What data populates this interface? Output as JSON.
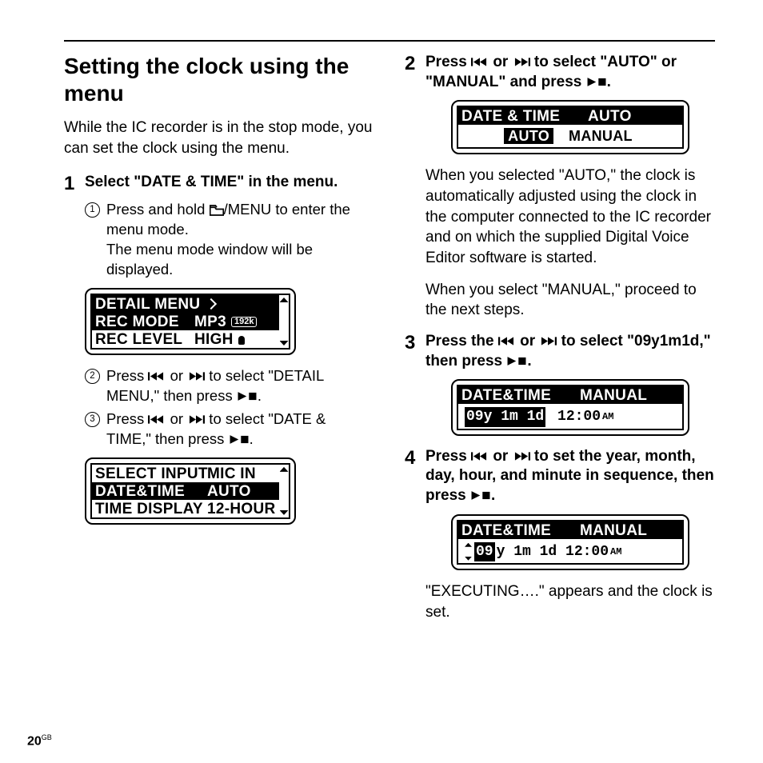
{
  "page_number": "20",
  "page_suffix": "GB",
  "left": {
    "title": "Setting the clock using the menu",
    "intro": "While the IC recorder is in the stop mode, you can set the clock using the menu.",
    "step1": {
      "num": "1",
      "head": "Select \"DATE & TIME\" in the menu.",
      "sub1_a": "Press and hold ",
      "sub1_b": "/MENU to enter the menu mode.",
      "sub1_after": "The menu mode window will be displayed.",
      "sub2_a": "Press ",
      "sub2_b": " or ",
      "sub2_c": " to select \"DETAIL MENU,\" then press ",
      "sub2_d": ".",
      "sub3_a": "Press ",
      "sub3_b": " or ",
      "sub3_c": " to select \"DATE & TIME,\" then press ",
      "sub3_d": "."
    }
  },
  "right": {
    "step2": {
      "num": "2",
      "head_a": "Press ",
      "head_b": " or ",
      "head_c": " to select \"AUTO\" or \"MANUAL\" and press ",
      "head_d": ".",
      "para1": "When you selected \"AUTO,\"  the clock is automatically adjusted using the clock in the computer connected to the IC recorder and on which the supplied Digital Voice Editor software is started.",
      "para2": "When you select \"MANUAL,\" proceed to the next steps."
    },
    "step3": {
      "num": "3",
      "head_a": "Press the ",
      "head_b": " or ",
      "head_c": " to select \"09y1m1d,\" then press ",
      "head_d": "."
    },
    "step4": {
      "num": "4",
      "head_a": "Press ",
      "head_b": " or ",
      "head_c": " to set the year, month, day, hour, and minute in sequence, then press ",
      "head_d": ".",
      "after": "\"EXECUTING….\" appears and the clock is set."
    }
  },
  "lcd": {
    "fig1": {
      "r1l": "DETAIL MENU",
      "r1r": "",
      "r2l": "REC MODE",
      "r2r": "MP3",
      "r3l": "REC LEVEL",
      "r3r": "HIGH",
      "badge": "192k"
    },
    "fig2": {
      "r1l": "SELECT INPUT",
      "r1r": "MIC IN",
      "r2l": "DATE&TIME",
      "r2r": "AUTO",
      "r3l": "TIME DISPLAY",
      "r3r": "12-HOUR"
    },
    "fig3": {
      "hdr_l": "DATE & TIME",
      "hdr_r": "AUTO",
      "opt1": "AUTO",
      "opt2": "MANUAL"
    },
    "fig4": {
      "hdr_l": "DATE&TIME",
      "hdr_r": "MANUAL",
      "date": "09y 1m 1d",
      "time": "12:00",
      "ampm": "AM"
    },
    "fig5": {
      "hdr_l": "DATE&TIME",
      "hdr_r": "MANUAL",
      "yy": "09",
      "rest": "y 1m 1d 12:00",
      "ampm": "AM"
    }
  }
}
